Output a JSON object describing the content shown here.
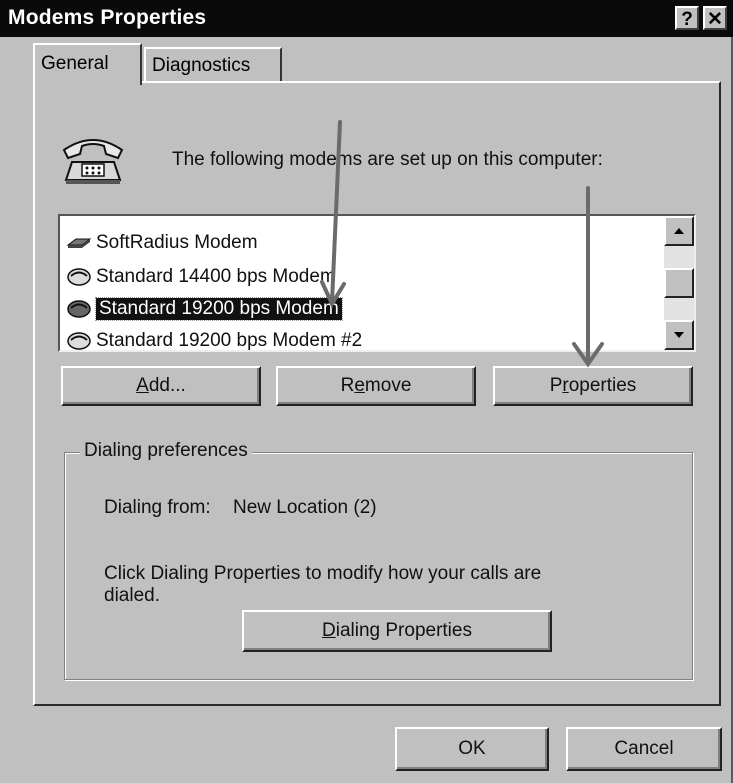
{
  "window": {
    "title": "Modems Properties",
    "help_glyph": "?",
    "close_glyph": "✕"
  },
  "tabs": [
    {
      "label": "General",
      "active": true
    },
    {
      "label": "Diagnostics",
      "active": false
    }
  ],
  "intro_text": "The following modems are set up on this computer:",
  "modems": [
    {
      "label": "SoftRadius Modem",
      "selected": false
    },
    {
      "label": "Standard 14400 bps Modem",
      "selected": false
    },
    {
      "label": "Standard 19200 bps Modem",
      "selected": true
    },
    {
      "label": "Standard 19200 bps Modem #2",
      "selected": false
    }
  ],
  "buttons": {
    "add": {
      "pre": "",
      "key": "A",
      "post": "dd..."
    },
    "remove": {
      "pre": "R",
      "key": "e",
      "post": "move"
    },
    "properties": {
      "pre": "P",
      "key": "r",
      "post": "operties"
    },
    "dialing_properties": {
      "pre": "",
      "key": "D",
      "post": "ialing Properties"
    },
    "ok": "OK",
    "cancel": "Cancel"
  },
  "dialing_preferences": {
    "group_label": "Dialing preferences",
    "dialing_from_label": "Dialing from:",
    "dialing_from_value": "New Location (2)",
    "hint_line1": "Click Dialing Properties to modify how your calls are",
    "hint_line2": "dialed."
  },
  "annotation_colors": {
    "arrow": "#6b6b6b"
  }
}
